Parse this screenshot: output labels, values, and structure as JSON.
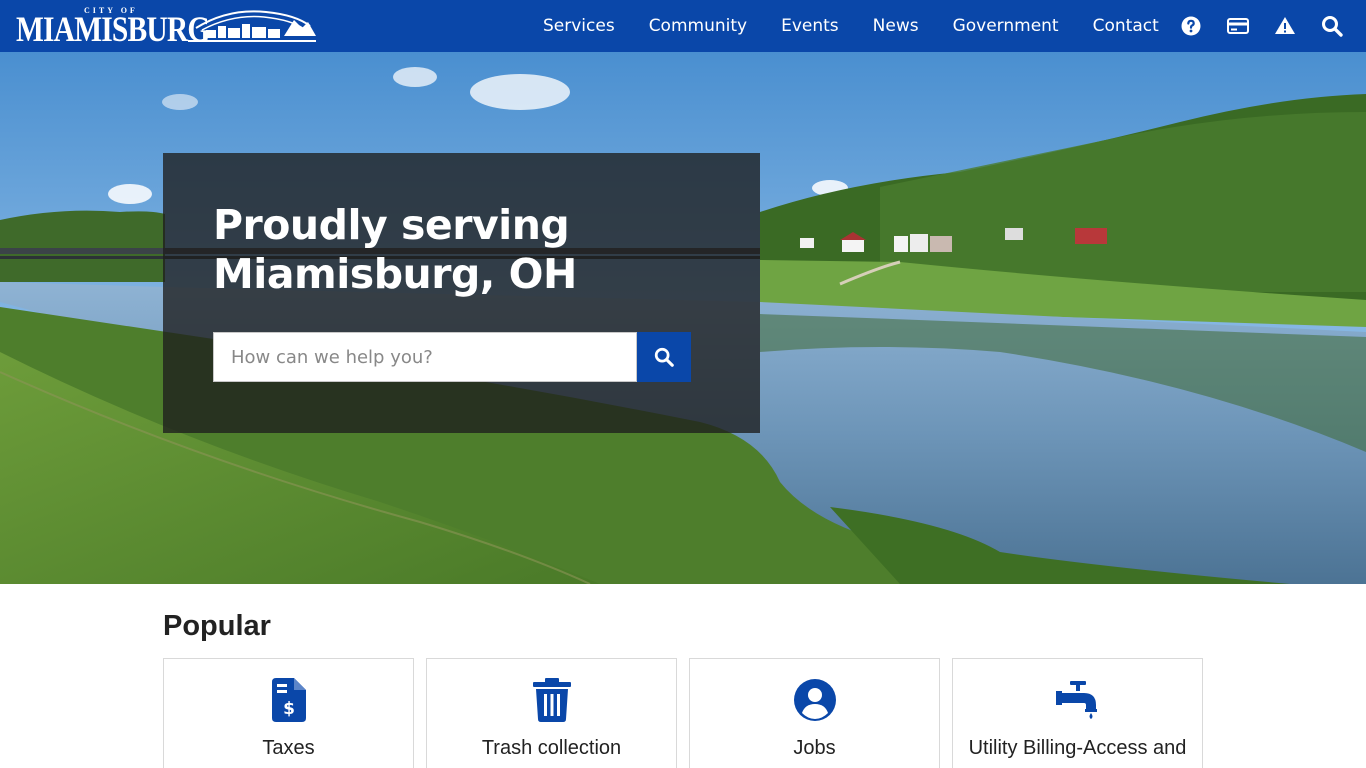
{
  "header": {
    "logo": {
      "small_text": "CITY OF",
      "word": "MIAMISBURG"
    },
    "nav": [
      {
        "label": "Services"
      },
      {
        "label": "Community"
      },
      {
        "label": "Events"
      },
      {
        "label": "News"
      },
      {
        "label": "Government"
      },
      {
        "label": "Contact"
      }
    ],
    "utility_icons": [
      "help-icon",
      "payment-card-icon",
      "alert-icon",
      "search-icon"
    ]
  },
  "hero": {
    "title_line1": "Proudly serving",
    "title_line2": "Miamisburg, OH",
    "search": {
      "placeholder": "How can we help you?",
      "button_icon": "search-icon"
    }
  },
  "popular": {
    "title": "Popular",
    "items": [
      {
        "label": "Taxes",
        "icon": "tax-document-icon"
      },
      {
        "label": "Trash collection",
        "icon": "trash-can-icon"
      },
      {
        "label": "Jobs",
        "icon": "user-circle-icon"
      },
      {
        "label": "Utility Billing-Access and",
        "icon": "water-faucet-icon"
      }
    ]
  },
  "colors": {
    "brand": "#0a47a9",
    "panel": "#1e1e1e",
    "text": "#222222"
  }
}
